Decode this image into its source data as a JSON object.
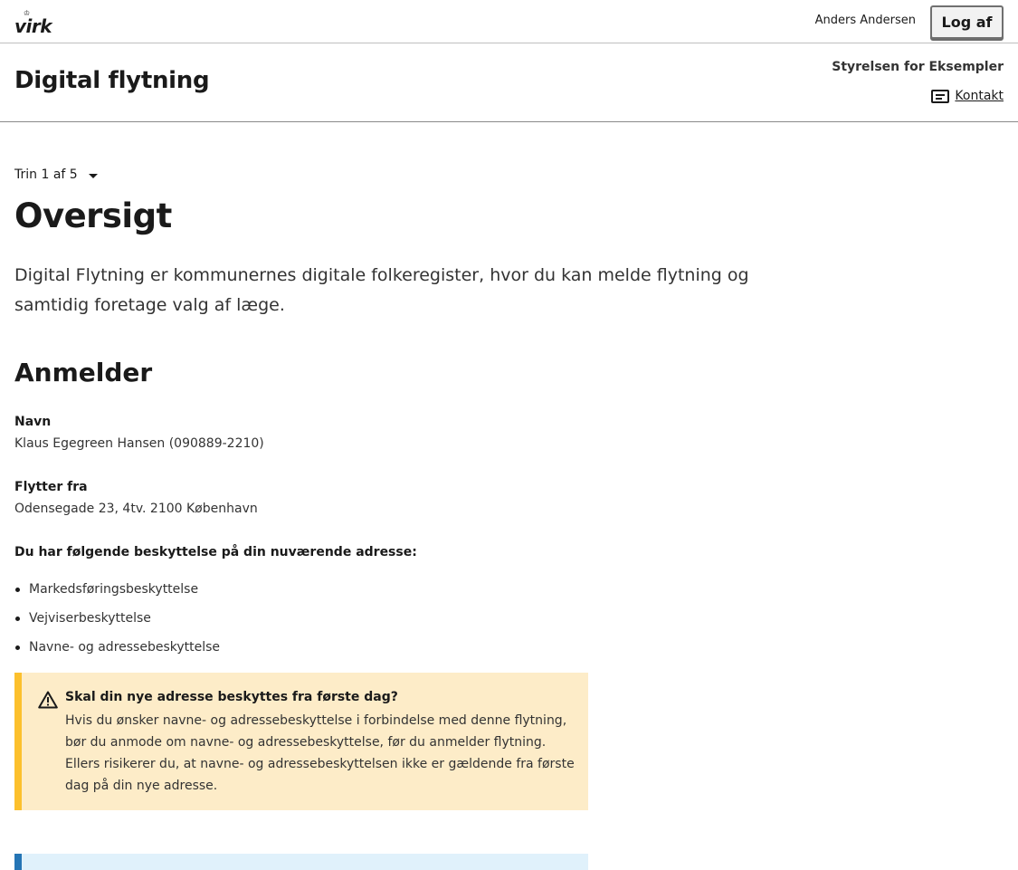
{
  "topbar": {
    "logo_text": "virk",
    "user_name": "Anders Andersen",
    "logout_label": "Log af"
  },
  "header": {
    "app_title": "Digital flytning",
    "org_name": "Styrelsen for Eksempler",
    "contact_label": "Kontakt"
  },
  "main": {
    "step_label": "Trin 1 af 5",
    "page_title": "Oversigt",
    "intro": "Digital Flytning er kommunernes digitale folkeregister, hvor du kan melde flytning og samtidig foretage valg af læge.",
    "section_title": "Anmelder",
    "fields": [
      {
        "label": "Navn",
        "value": "Klaus Egegreen Hansen (090889-2210)"
      },
      {
        "label": "Flytter fra",
        "value": "Odensegade 23, 4tv. 2100 København"
      }
    ],
    "protection_heading": "Du har følgende beskyttelse på din nuværende adresse:",
    "protections": [
      "Markedsføringsbeskyttelse",
      "Vejviserbeskyttelse",
      "Navne- og adressebeskyttelse"
    ],
    "alert": {
      "icon": "warning-icon",
      "title": "Skal din nye adresse beskyttes fra første dag?",
      "text": "Hvis du ønsker navne- og adressebeskyttelse i forbindelse med denne flytning, bør du anmode om navne- og adressebeskyttelse, før du anmelder flytning. Ellers risikerer du, at navne- og adressebeskyttelsen ikke er gældende fra første dag på din nye adresse."
    }
  },
  "colors": {
    "alert_background": "#fdecc8",
    "alert_border": "#fcc02d",
    "info_background": "#e0f1fb",
    "info_border": "#2575b5"
  }
}
